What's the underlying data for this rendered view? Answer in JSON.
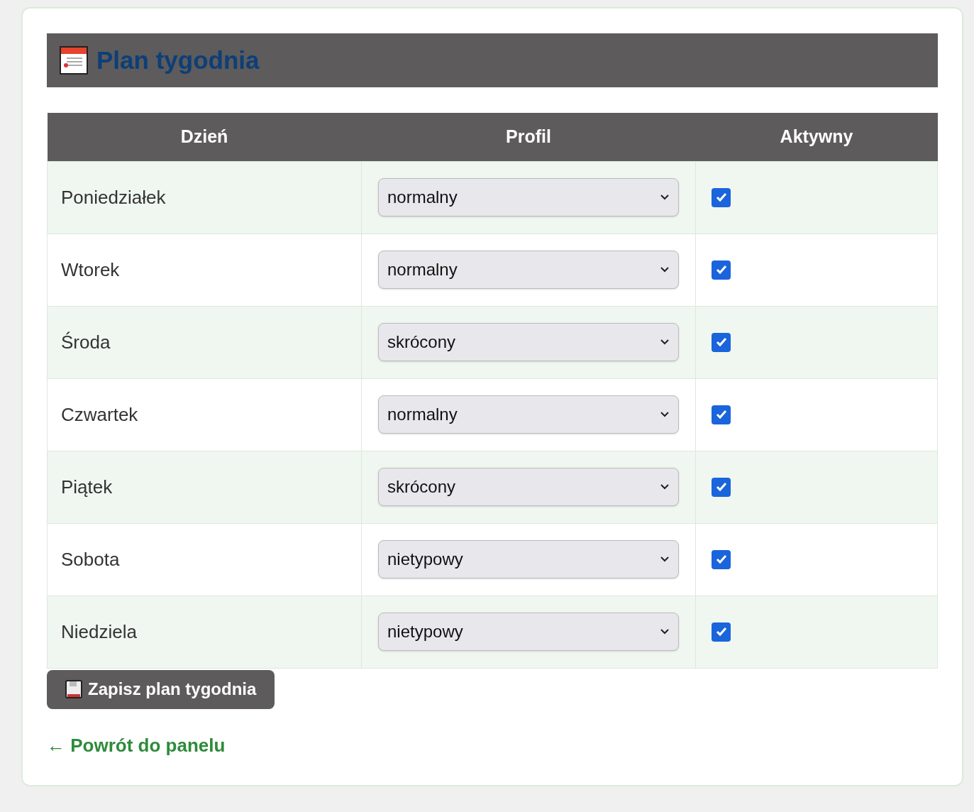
{
  "title": "Plan tygodnia",
  "table": {
    "columns": [
      "Dzień",
      "Profil",
      "Aktywny"
    ],
    "rows": [
      {
        "day": "Poniedziałek",
        "profile": "normalny",
        "active": true
      },
      {
        "day": "Wtorek",
        "profile": "normalny",
        "active": true
      },
      {
        "day": "Środa",
        "profile": "skrócony",
        "active": true
      },
      {
        "day": "Czwartek",
        "profile": "normalny",
        "active": true
      },
      {
        "day": "Piątek",
        "profile": "skrócony",
        "active": true
      },
      {
        "day": "Sobota",
        "profile": "nietypowy",
        "active": true
      },
      {
        "day": "Niedziela",
        "profile": "nietypowy",
        "active": true
      }
    ]
  },
  "save_button": "Zapisz plan tygodnia",
  "back_link": "← Powrót do panelu"
}
